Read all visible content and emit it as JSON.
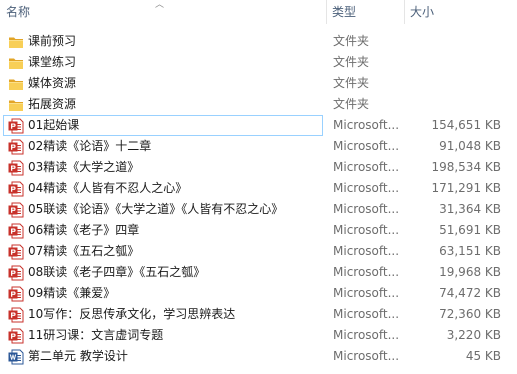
{
  "header": {
    "name": "名称",
    "type": "类型",
    "size": "大小"
  },
  "colors": {
    "header_text": "#4c607a",
    "folder": "#f5c342",
    "pdf": "#c8322b",
    "word": "#2b5797",
    "selection": "#99d1ff"
  },
  "rows": [
    {
      "name": "课前预习",
      "type": "文件夹",
      "size": "",
      "icon": "folder-icon"
    },
    {
      "name": "课堂练习",
      "type": "文件夹",
      "size": "",
      "icon": "folder-icon"
    },
    {
      "name": "媒体资源",
      "type": "文件夹",
      "size": "",
      "icon": "folder-icon"
    },
    {
      "name": "拓展资源",
      "type": "文件夹",
      "size": "",
      "icon": "folder-icon"
    },
    {
      "name": "01起始课",
      "type": "Microsoft...",
      "size": "154,651 KB",
      "icon": "powerpoint-icon"
    },
    {
      "name": "02精读《论语》十二章",
      "type": "Microsoft...",
      "size": "91,048 KB",
      "icon": "powerpoint-icon"
    },
    {
      "name": "03精读《大学之道》",
      "type": "Microsoft...",
      "size": "198,534 KB",
      "icon": "powerpoint-icon"
    },
    {
      "name": "04精读《人皆有不忍人之心》",
      "type": "Microsoft...",
      "size": "171,291 KB",
      "icon": "powerpoint-icon"
    },
    {
      "name": "05联读《论语》《大学之道》《人皆有不忍之心》",
      "type": "Microsoft...",
      "size": "31,364 KB",
      "icon": "powerpoint-icon"
    },
    {
      "name": "06精读《老子》四章",
      "type": "Microsoft...",
      "size": "51,691 KB",
      "icon": "powerpoint-icon"
    },
    {
      "name": "07精读《五石之瓠》",
      "type": "Microsoft...",
      "size": "63,151 KB",
      "icon": "powerpoint-icon"
    },
    {
      "name": "08联读《老子四章》《五石之瓠》",
      "type": "Microsoft...",
      "size": "19,968 KB",
      "icon": "powerpoint-icon"
    },
    {
      "name": "09精读《兼爱》",
      "type": "Microsoft...",
      "size": "74,472 KB",
      "icon": "powerpoint-icon"
    },
    {
      "name": "10写作：反思传承文化，学习思辨表达",
      "type": "Microsoft...",
      "size": "72,360 KB",
      "icon": "powerpoint-icon"
    },
    {
      "name": "11研习课：文言虚词专题",
      "type": "Microsoft...",
      "size": "3,220 KB",
      "icon": "powerpoint-icon"
    },
    {
      "name": "第二单元 教学设计",
      "type": "Microsoft...",
      "size": "45 KB",
      "icon": "word-doc-icon"
    }
  ]
}
